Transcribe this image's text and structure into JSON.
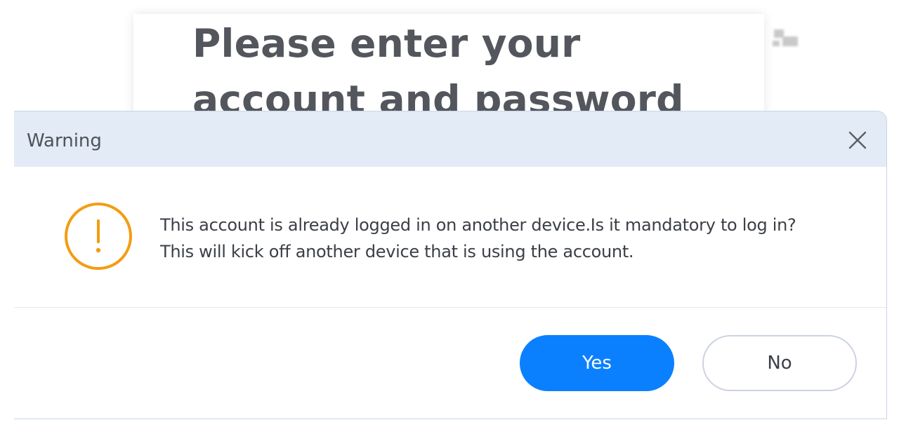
{
  "background": {
    "heading": "Please enter your account and password"
  },
  "dialog": {
    "title": "Warning",
    "close_icon": "close-icon",
    "warning_icon": "exclamation-circle-icon",
    "message": "This account is already logged in on another device.Is it mandatory to log in? This will kick off another device that is using the account.",
    "buttons": {
      "yes_label": "Yes",
      "no_label": "No"
    }
  },
  "colors": {
    "header_bg": "#e3ebf7",
    "primary": "#0a80ff",
    "warning": "#f39c12",
    "text": "#3b3f46"
  }
}
